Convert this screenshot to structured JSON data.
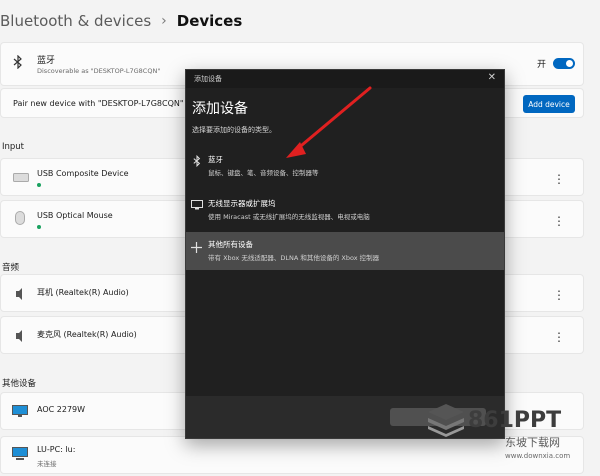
{
  "breadcrumb": {
    "parent": "Bluetooth & devices",
    "separator": "›",
    "current": "Devices"
  },
  "bluetooth": {
    "title": "蓝牙",
    "subtitle": "Discoverable as \"DESKTOP-L7G8CQN\"",
    "toggle_label": "开"
  },
  "pair": {
    "text": "Pair new device with \"DESKTOP-L7G8CQN\"",
    "button": "Add device"
  },
  "sections": {
    "input": "Input",
    "audio": "音频",
    "other": "其他设备"
  },
  "input_devices": [
    {
      "name": "USB Composite Device",
      "icon": "keyboard-icon"
    },
    {
      "name": "USB Optical Mouse",
      "icon": "mouse-icon"
    }
  ],
  "audio_devices": [
    {
      "name": "耳机 (Realtek(R) Audio)",
      "icon": "speaker-icon"
    },
    {
      "name": "麦克风 (Realtek(R) Audio)",
      "icon": "speaker-icon"
    }
  ],
  "other_devices": [
    {
      "name": "AOC 2279W",
      "subtitle": "",
      "icon": "monitor-icon"
    },
    {
      "name": "LU-PC: lu:",
      "subtitle": "未连接",
      "icon": "pc-icon"
    }
  ],
  "kebab": "⋮",
  "dialog": {
    "window_title": "添加设备",
    "close": "✕",
    "heading": "添加设备",
    "subheading": "选择要添加的设备的类型。",
    "options": [
      {
        "title": "蓝牙",
        "desc": "鼠标、键盘、笔、音频设备、控制器等",
        "icon": "bluetooth-icon"
      },
      {
        "title": "无线显示器或扩展坞",
        "desc": "使用 Miracast 或无线扩展坞的无线监视器、电视或电脑",
        "icon": "display-icon"
      },
      {
        "title": "其他所有设备",
        "desc": "带有 Xbox 无线适配器、DLNA 和其他设备的 Xbox 控制器",
        "icon": "plus-icon"
      }
    ]
  },
  "watermark": {
    "brand": "861PPT",
    "cn": "东坡下载网",
    "url": "www.downxia.com"
  },
  "colors": {
    "accent": "#0067c0",
    "dialog_bg": "#202020",
    "status_green": "#1aa260"
  }
}
